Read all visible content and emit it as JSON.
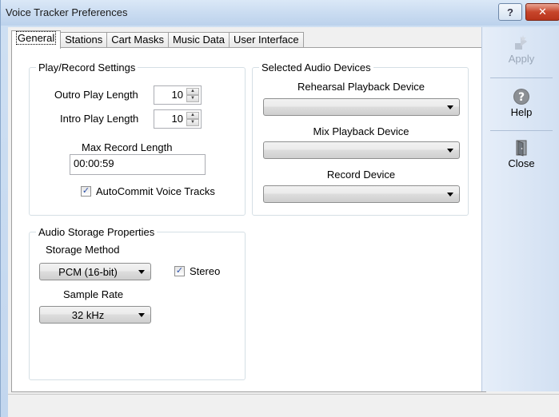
{
  "window": {
    "title": "Voice Tracker Preferences",
    "help_glyph": "?",
    "close_glyph": "✕"
  },
  "tabs": [
    {
      "label": "General",
      "active": true
    },
    {
      "label": "Stations"
    },
    {
      "label": "Cart Masks"
    },
    {
      "label": "Music Data"
    },
    {
      "label": "User Interface"
    }
  ],
  "play_record": {
    "legend": "Play/Record Settings",
    "outro_label": "Outro Play Length",
    "outro_value": "10",
    "intro_label": "Intro Play Length",
    "intro_value": "10",
    "max_record_label": "Max Record Length",
    "max_record_value": "00:00:59",
    "autocommit_label": "AutoCommit Voice Tracks",
    "autocommit_checked": true
  },
  "audio_devices": {
    "legend": "Selected Audio Devices",
    "rehearsal_label": "Rehearsal Playback Device",
    "rehearsal_value": "",
    "mix_label": "Mix Playback Device",
    "mix_value": "",
    "record_label": "Record Device",
    "record_value": ""
  },
  "audio_storage": {
    "legend": "Audio Storage Properties",
    "method_label": "Storage Method",
    "method_value": "PCM (16-bit)",
    "stereo_label": "Stereo",
    "stereo_checked": true,
    "sample_rate_label": "Sample Rate",
    "sample_rate_value": "32 kHz"
  },
  "sidebar": {
    "apply_label": "Apply",
    "help_label": "Help",
    "close_label": "Close"
  },
  "colors": {
    "accent": "#2b4fa8",
    "close_red": "#c7452b",
    "sidebar": "#d2e0f2"
  }
}
